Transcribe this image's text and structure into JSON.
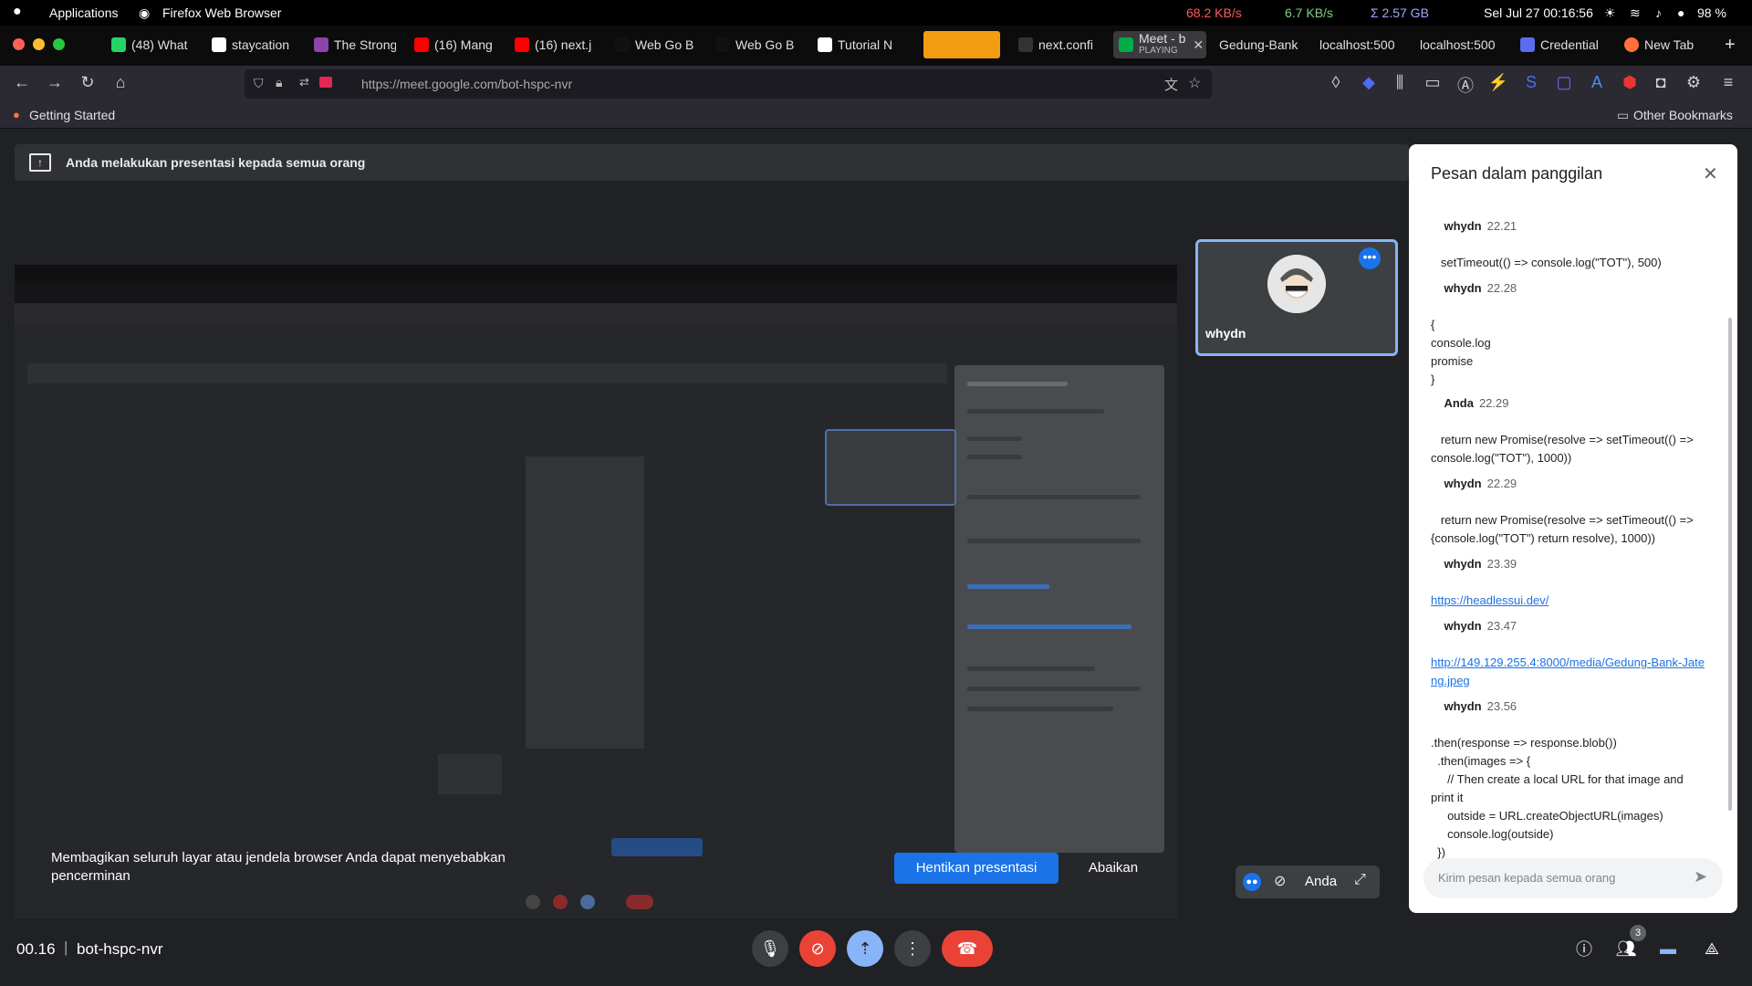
{
  "system_bar": {
    "apps_label": "Applications",
    "window_label": "Firefox Web Browser",
    "net_up": "68.2 KB/s",
    "net_down": "6.7 KB/s",
    "memory": "Σ 2.57 GB",
    "clock": "Sel Jul 27  00:16:56",
    "battery": "98 %"
  },
  "tabs": [
    {
      "label": "(48) What",
      "color": "#25d366"
    },
    {
      "label": "staycation",
      "color": "#ffffff"
    },
    {
      "label": "The Strong",
      "color": "#8e44ad"
    },
    {
      "label": "(16) Mang",
      "color": "#ff0000"
    },
    {
      "label": "(16) next.j",
      "color": "#ff0000"
    },
    {
      "label": "Web Go B",
      "color": "#111111"
    },
    {
      "label": "Web Go B",
      "color": "#111111"
    },
    {
      "label": "Tutorial N",
      "color": "#ffffff"
    },
    {
      "label": "next.confi",
      "color": "#333333"
    },
    {
      "label": "Meet - b",
      "sub": "PLAYING",
      "color": "#00ac47"
    },
    {
      "label": "Gedung-Bank",
      "color": "#777777"
    },
    {
      "label": "localhost:500",
      "color": "#777777"
    },
    {
      "label": "localhost:500",
      "color": "#777777"
    },
    {
      "label": "Credential",
      "color": "#5b6cf0"
    },
    {
      "label": "New Tab",
      "color": "#ff7139"
    }
  ],
  "url": "https://meet.google.com/bot-hspc-nvr",
  "bookmarks": {
    "getting_started": "Getting Started",
    "other": "Other Bookmarks"
  },
  "meet": {
    "presenting_banner": "Anda melakukan presentasi kepada semua orang",
    "participant_name": "whydn",
    "share_warning": "Membagikan seluruh layar atau jendela browser Anda dapat menyebabkan pencerminan",
    "stop_presenting": "Hentikan presentasi",
    "dismiss": "Abaikan",
    "self_label": "Anda",
    "meeting_time": "00.16",
    "meeting_code": "bot-hspc-nvr",
    "people_count": "3"
  },
  "chat": {
    "title": "Pesan dalam panggilan",
    "input_placeholder": "Kirim pesan kepada semua orang",
    "messages": [
      {
        "sender": "whydn",
        "time": "22.21",
        "text": "   setTimeout(() => console.log(\"TOT\"), 500)"
      },
      {
        "sender": "whydn",
        "time": "22.28",
        "text": "{\nconsole.log\npromise\n}"
      },
      {
        "sender": "Anda",
        "time": "22.29",
        "text": "   return new Promise(resolve => setTimeout(() => console.log(\"TOT\"), 1000))"
      },
      {
        "sender": "whydn",
        "time": "22.29",
        "text": "   return new Promise(resolve => setTimeout(() => {console.log(\"TOT\") return resolve), 1000))"
      },
      {
        "sender": "whydn",
        "time": "23.39",
        "link": "https://headlessui.dev/"
      },
      {
        "sender": "whydn",
        "time": "23.47",
        "link": "http://149.129.255.4:8000/media/Gedung-Bank-Jateng.jpeg"
      },
      {
        "sender": "whydn",
        "time": "23.56",
        "text": ".then(response => response.blob())\n  .then(images => {\n     // Then create a local URL for that image and print it\n     outside = URL.createObjectURL(images)\n     console.log(outside)\n  })"
      }
    ]
  }
}
